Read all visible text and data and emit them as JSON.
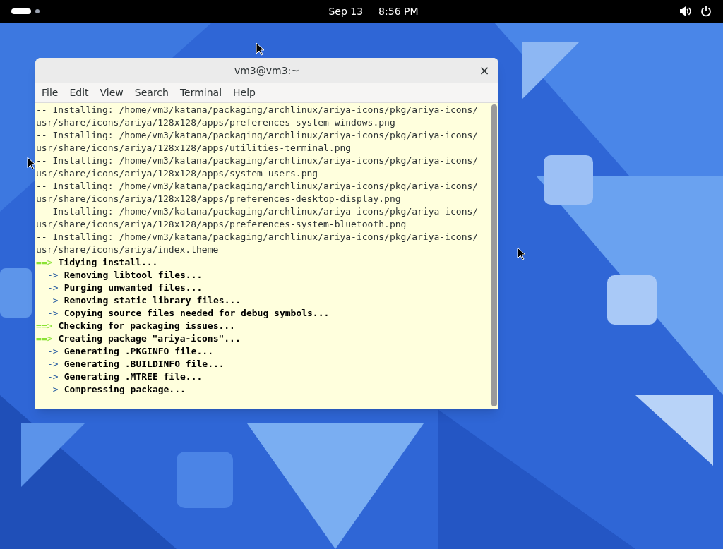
{
  "top_bar": {
    "date": "Sep 13",
    "time": "8:56 PM"
  },
  "window": {
    "title": "vm3@vm3:~",
    "close": "×"
  },
  "menu": [
    "File",
    "Edit",
    "View",
    "Search",
    "Terminal",
    "Help"
  ],
  "terminal_lines": [
    {
      "kind": "plain",
      "text": "-- Installing: /home/vm3/katana/packaging/archlinux/ariya-icons/pkg/ariya-icons/"
    },
    {
      "kind": "plain",
      "text": "usr/share/icons/ariya/128x128/apps/preferences-system-windows.png"
    },
    {
      "kind": "plain",
      "text": "-- Installing: /home/vm3/katana/packaging/archlinux/ariya-icons/pkg/ariya-icons/"
    },
    {
      "kind": "plain",
      "text": "usr/share/icons/ariya/128x128/apps/utilities-terminal.png"
    },
    {
      "kind": "plain",
      "text": "-- Installing: /home/vm3/katana/packaging/archlinux/ariya-icons/pkg/ariya-icons/"
    },
    {
      "kind": "plain",
      "text": "usr/share/icons/ariya/128x128/apps/system-users.png"
    },
    {
      "kind": "plain",
      "text": "-- Installing: /home/vm3/katana/packaging/archlinux/ariya-icons/pkg/ariya-icons/"
    },
    {
      "kind": "plain",
      "text": "usr/share/icons/ariya/128x128/apps/preferences-desktop-display.png"
    },
    {
      "kind": "plain",
      "text": "-- Installing: /home/vm3/katana/packaging/archlinux/ariya-icons/pkg/ariya-icons/"
    },
    {
      "kind": "plain",
      "text": "usr/share/icons/ariya/128x128/apps/preferences-system-bluetooth.png"
    },
    {
      "kind": "plain",
      "text": "-- Installing: /home/vm3/katana/packaging/archlinux/ariya-icons/pkg/ariya-icons/"
    },
    {
      "kind": "plain",
      "text": "usr/share/icons/ariya/index.theme"
    },
    {
      "kind": "main",
      "arrow": "==>",
      "text": "Tidying install..."
    },
    {
      "kind": "sub",
      "arrow": "->",
      "text": "Removing libtool files..."
    },
    {
      "kind": "sub",
      "arrow": "->",
      "text": "Purging unwanted files..."
    },
    {
      "kind": "sub",
      "arrow": "->",
      "text": "Removing static library files..."
    },
    {
      "kind": "sub",
      "arrow": "->",
      "text": "Copying source files needed for debug symbols..."
    },
    {
      "kind": "main",
      "arrow": "==>",
      "text": "Checking for packaging issues..."
    },
    {
      "kind": "main",
      "arrow": "==>",
      "text": "Creating package \"ariya-icons\"..."
    },
    {
      "kind": "sub",
      "arrow": "->",
      "text": "Generating .PKGINFO file..."
    },
    {
      "kind": "sub",
      "arrow": "->",
      "text": "Generating .BUILDINFO file..."
    },
    {
      "kind": "sub",
      "arrow": "->",
      "text": "Generating .MTREE file..."
    },
    {
      "kind": "sub",
      "arrow": "->",
      "text": "Compressing package..."
    }
  ]
}
